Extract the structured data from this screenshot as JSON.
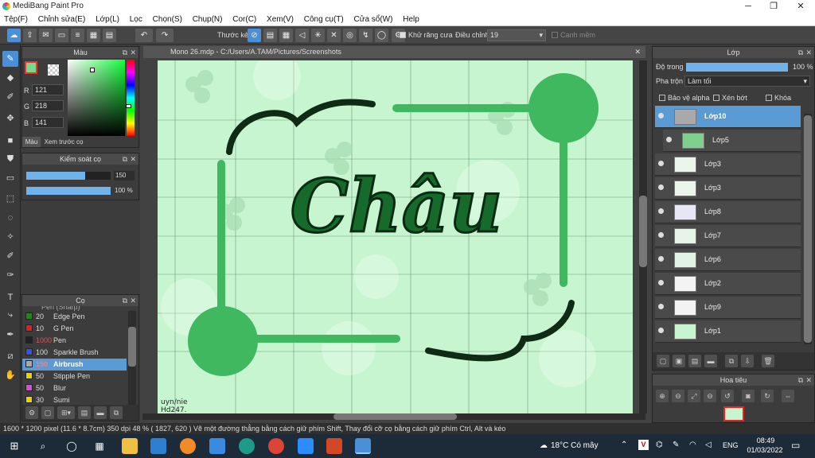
{
  "window": {
    "title": "MediBang Paint Pro",
    "min": "─",
    "max": "❐",
    "close": "✕"
  },
  "menu": [
    "Tệp(F)",
    "Chỉnh sửa(E)",
    "Lớp(L)",
    "Lọc",
    "Chọn(S)",
    "Chụp(N)",
    "Cor(C)",
    "Xem(V)",
    "Công cụ(T)",
    "Cửa sổ(W)",
    "Help"
  ],
  "toolbar": {
    "ruler_label": "Thước kẻ",
    "antialias_label": "Khử răng cưa",
    "correction_label": "Điều chỉnh",
    "correction_value": "19",
    "snap_label": "Canh mềm"
  },
  "color_panel": {
    "title": "Màu",
    "r_label": "R",
    "r_value": "121",
    "g_label": "G",
    "g_value": "218",
    "b_label": "B",
    "b_value": "141",
    "tab_color": "Màu",
    "tab_preview": "Xem trước cọ",
    "current_color": "#79da8d"
  },
  "brush_control": {
    "title": "Kiểm soát cọ",
    "size_value": "150",
    "opacity_value": "100 %",
    "size_fraction": 0.7,
    "opacity_fraction": 1.0
  },
  "brush_panel": {
    "title": "Cọ",
    "partial_top": "Pen (Sharp)",
    "items": [
      {
        "size": "20",
        "name": "Edge Pen",
        "color": "#1b8a1b"
      },
      {
        "size": "10",
        "name": "G Pen",
        "color": "#e02020"
      },
      {
        "size": "1000",
        "name": "Pen",
        "color": "#222222"
      },
      {
        "size": "100",
        "name": "Sparkle Brush",
        "color": "#3355dd"
      },
      {
        "size": "150",
        "name": "Airbrush",
        "color": "#aaaaaa",
        "selected": true
      },
      {
        "size": "50",
        "name": "Stipple Pen",
        "color": "#e8d200"
      },
      {
        "size": "50",
        "name": "Blur",
        "color": "#cc55cc"
      },
      {
        "size": "30",
        "name": "Sumi",
        "color": "#e8d200"
      }
    ]
  },
  "canvas": {
    "tab_title": "Mono 26.mdp - C:/Users/A.TAM/Pictures/Screenshots",
    "artwork_text": "Châu",
    "signature": "uyn/nie\nHd247."
  },
  "layer_panel": {
    "title": "Lớp",
    "opacity_label": "Độ trong",
    "opacity_value": "100 %",
    "opacity_fraction": 1.0,
    "blend_label": "Pha trộn",
    "blend_value": "Làm tối",
    "protect_alpha": "Bảo vệ alpha",
    "clip": "Xén bớt",
    "lock": "Khóa",
    "layers": [
      {
        "name": "Lớp10",
        "selected": true
      },
      {
        "name": "Lớp5"
      },
      {
        "name": "Lớp3"
      },
      {
        "name": "Lớp3"
      },
      {
        "name": "Lớp8"
      },
      {
        "name": "Lớp7"
      },
      {
        "name": "Lớp6"
      },
      {
        "name": "Lớp2"
      },
      {
        "name": "Lớp9"
      },
      {
        "name": "Lớp1"
      }
    ]
  },
  "navigator": {
    "title": "Hoa tiêu"
  },
  "status": {
    "text": "1600 * 1200 pixel   (11.6 * 8.7cm)   350 dpi   48 %   ( 1827, 620 )   Vẽ một đường thẳng bằng cách giữ phím Shift, Thay đổi cỡ cọ bằng cách giữ phím Ctrl, Alt và kéo"
  },
  "taskbar": {
    "weather": "18°C  Có mây",
    "lang": "ENG",
    "time": "08:49",
    "date": "01/03/2022"
  }
}
